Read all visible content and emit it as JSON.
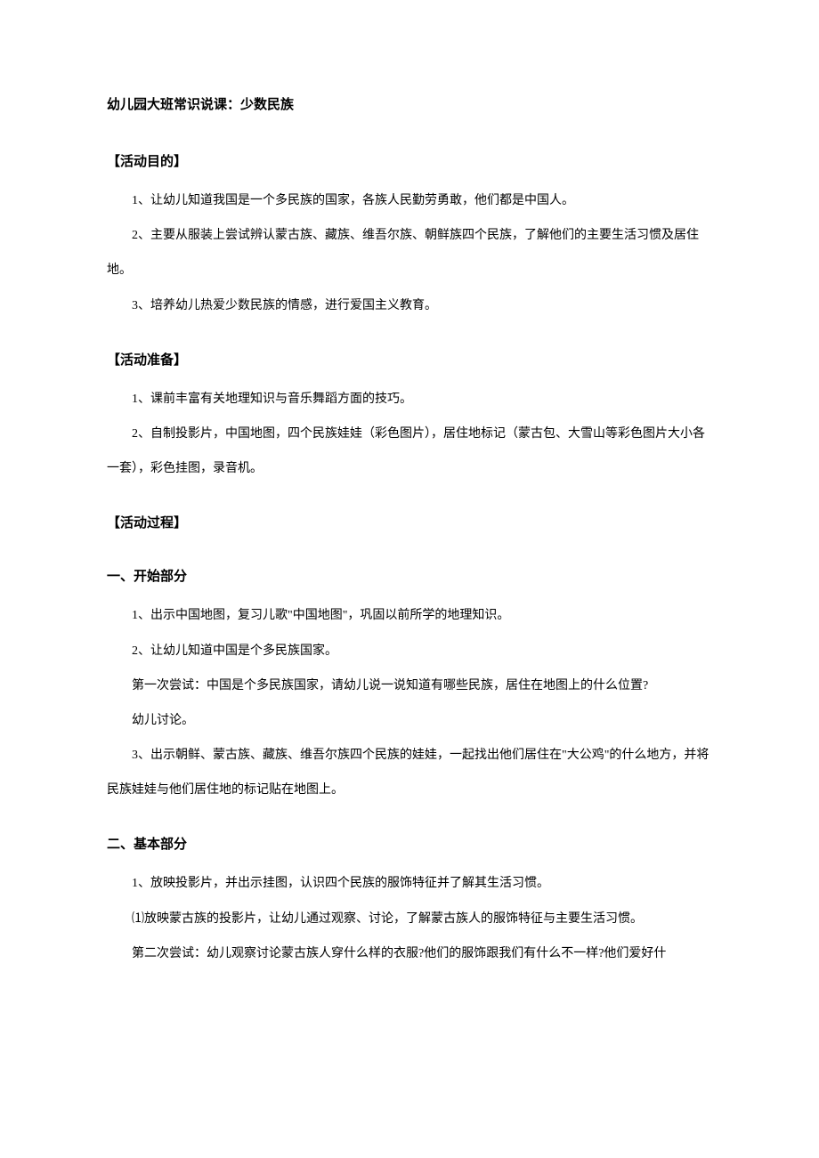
{
  "title": "幼儿园大班常识说课：少数民族",
  "sections": {
    "goals": {
      "heading": "【活动目的】",
      "items": [
        "1、让幼儿知道我国是一个多民族的国家，各族人民勤劳勇敢，他们都是中国人。",
        "2、主要从服装上尝试辨认蒙古族、藏族、维吾尔族、朝鲜族四个民族，了解他们的主要生活习惯及居住地。",
        "3、培养幼儿热爱少数民族的情感，进行爱国主义教育。"
      ]
    },
    "prep": {
      "heading": "【活动准备】",
      "items": [
        "1、课前丰富有关地理知识与音乐舞蹈方面的技巧。",
        "2、自制投影片，中国地图，四个民族娃娃（彩色图片），居住地标记（蒙古包、大雪山等彩色图片大小各一套），彩色挂图，录音机。"
      ]
    },
    "process": {
      "heading": "【活动过程】",
      "part1": {
        "heading": "一、开始部分",
        "items": [
          "1、出示中国地图，复习儿歌\"中国地图\"，巩固以前所学的地理知识。",
          "2、让幼儿知道中国是个多民族国家。",
          "第一次尝试：中国是个多民族国家，请幼儿说一说知道有哪些民族，居住在地图上的什么位置?",
          "幼儿讨论。",
          "3、出示朝鲜、蒙古族、藏族、维吾尔族四个民族的娃娃，一起找出他们居住在\"大公鸡\"的什么地方，并将民族娃娃与他们居住地的标记贴在地图上。"
        ]
      },
      "part2": {
        "heading": "二、基本部分",
        "items": [
          "1、放映投影片，并出示挂图，认识四个民族的服饰特征并了解其生活习惯。",
          "⑴放映蒙古族的投影片，让幼儿通过观察、讨论，了解蒙古族人的服饰特征与主要生活习惯。",
          "第二次尝试：幼儿观察讨论蒙古族人穿什么样的衣服?他们的服饰跟我们有什么不一样?他们爱好什"
        ]
      }
    }
  }
}
